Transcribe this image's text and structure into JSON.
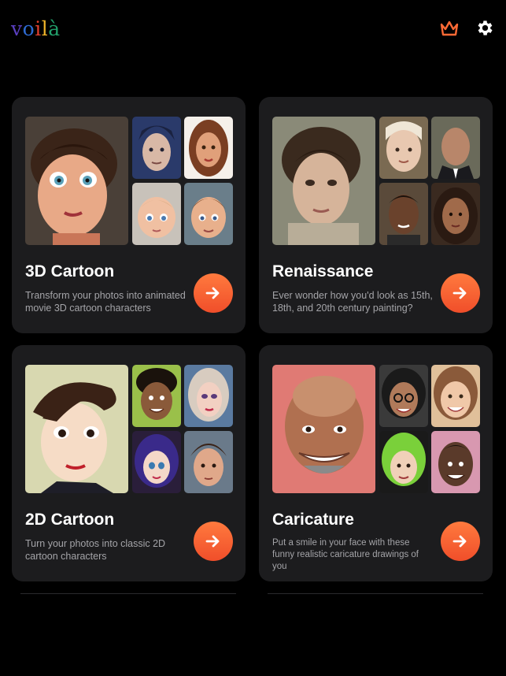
{
  "app": {
    "logo_letters": [
      {
        "ch": "v",
        "color": "#5a3fc0"
      },
      {
        "ch": "o",
        "color": "#2e6ad0"
      },
      {
        "ch": "i",
        "color": "#e0402e"
      },
      {
        "ch": "l",
        "color": "#f0b429"
      },
      {
        "ch": "à",
        "color": "#22a06b"
      }
    ],
    "header_icons": [
      "crown-icon",
      "gear-icon"
    ],
    "accent": "#ff6a35"
  },
  "cards": [
    {
      "title": "3D Cartoon",
      "description": "Transform your photos into animated movie 3D cartoon characters",
      "action_icon": "arrow-right-icon"
    },
    {
      "title": "Renaissance",
      "description": "Ever wonder how you'd look as 15th, 18th, and 20th century painting?",
      "action_icon": "arrow-right-icon"
    },
    {
      "title": "2D Cartoon",
      "description": "Turn your photos into classic 2D cartoon characters",
      "action_icon": "arrow-right-icon"
    },
    {
      "title": "Caricature",
      "description": "Put a smile in your face with these funny realistic caricature drawings of you",
      "action_icon": "arrow-right-icon"
    }
  ]
}
